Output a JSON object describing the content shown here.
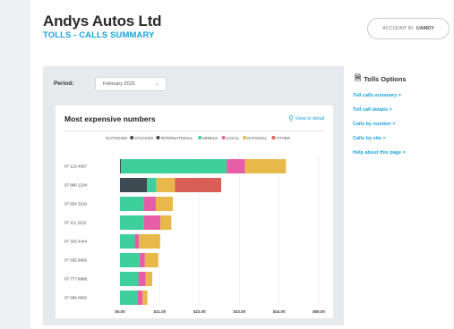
{
  "header": {
    "company": "Andys Autos Ltd",
    "subtitle": "TOLLS - CALLS SUMMARY",
    "account_label": "ACCOUNT ID:",
    "account_value": "UAMDY"
  },
  "filters": {
    "period_label": "Period:",
    "period_value": "February 2016"
  },
  "chart_card": {
    "title": "Most expensive numbers",
    "view_detail": "View in detail"
  },
  "sidebar": {
    "title": "Tolls Options",
    "links": [
      "Toll calls summary >",
      "Toll call details >",
      "Calls by number >",
      "Calls by site >",
      "Help about this page >"
    ]
  },
  "colors": {
    "accent": "#1aa3de",
    "outgoing": "#3e4a52",
    "international": "#3fcf9c",
    "mobile": "#e65ea8",
    "local": "#e8b84a",
    "national": "#d95e56"
  },
  "chart_data": {
    "type": "bar",
    "orientation": "horizontal",
    "stacked": true,
    "categories": [
      "07 123 4567",
      "07 890 1234",
      "07 654 3210",
      "07 111 2222",
      "07 333 4444",
      "07 555 6666",
      "07 777 8888",
      "07 999 0000"
    ],
    "legend": [
      "OUTGOING",
      "STACKED",
      "INTERNATIONAL",
      "MOBILE",
      "LOCAL",
      "NATIONAL",
      "OTHER"
    ],
    "series": [
      {
        "name": "OUTGOING",
        "color": "#3e4a52",
        "values": [
          0.3,
          7.5,
          0,
          0,
          0,
          0,
          0,
          0
        ]
      },
      {
        "name": "INTERNATIONAL",
        "color": "#3fcf9c",
        "values": [
          29.2,
          2.6,
          6.6,
          6.6,
          4.1,
          5.4,
          5.1,
          4.8
        ]
      },
      {
        "name": "MOBILE",
        "color": "#e65ea8",
        "values": [
          5.1,
          0,
          3.3,
          4.6,
          1.1,
          1.5,
          2.0,
          1.4
        ]
      },
      {
        "name": "LOCAL",
        "color": "#e8b84a",
        "values": [
          11.3,
          5.1,
          4.7,
          3.0,
          5.9,
          3.7,
          1.8,
          1.4
        ]
      },
      {
        "name": "NATIONAL",
        "color": "#d95e56",
        "values": [
          0,
          12.8,
          0,
          0,
          0,
          0,
          0,
          0
        ]
      }
    ],
    "x_ticks": [
      "$0.00",
      "$11.00",
      "$22.00",
      "$33.00",
      "$44.00",
      "$55.00"
    ],
    "xlim": [
      0,
      55
    ]
  }
}
